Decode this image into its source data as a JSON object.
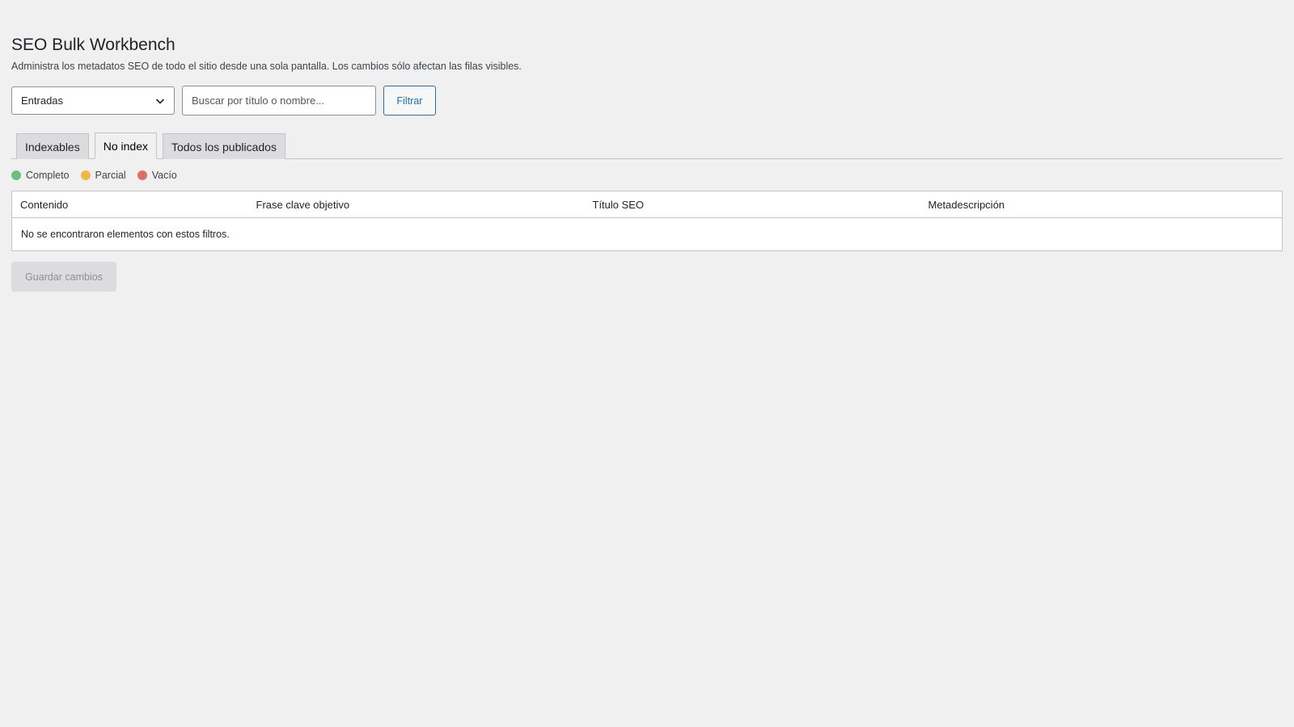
{
  "page": {
    "title": "SEO Bulk Workbench",
    "description": "Administra los metadatos SEO de todo el sitio desde una sola pantalla. Los cambios sólo afectan las filas visibles."
  },
  "filters": {
    "post_type_selected": "Entradas",
    "search_placeholder": "Buscar por título o nombre...",
    "search_value": "",
    "filter_label": "Filtrar"
  },
  "tabs": [
    {
      "label": "Indexables",
      "active": false
    },
    {
      "label": "No index",
      "active": true
    },
    {
      "label": "Todos los publicados",
      "active": false
    }
  ],
  "legend": [
    {
      "label": "Completo",
      "color": "#68c17c"
    },
    {
      "label": "Parcial",
      "color": "#f0b849"
    },
    {
      "label": "Vacío",
      "color": "#e06c6c"
    }
  ],
  "table": {
    "columns": [
      "Contenido",
      "Frase clave objetivo",
      "Título SEO",
      "Metadescripción"
    ],
    "empty_message": "No se encontraron elementos con estos filtros."
  },
  "actions": {
    "save_label": "Guardar cambios"
  },
  "colors": {
    "accent": "#2271b1",
    "background": "#f0f0f1"
  }
}
